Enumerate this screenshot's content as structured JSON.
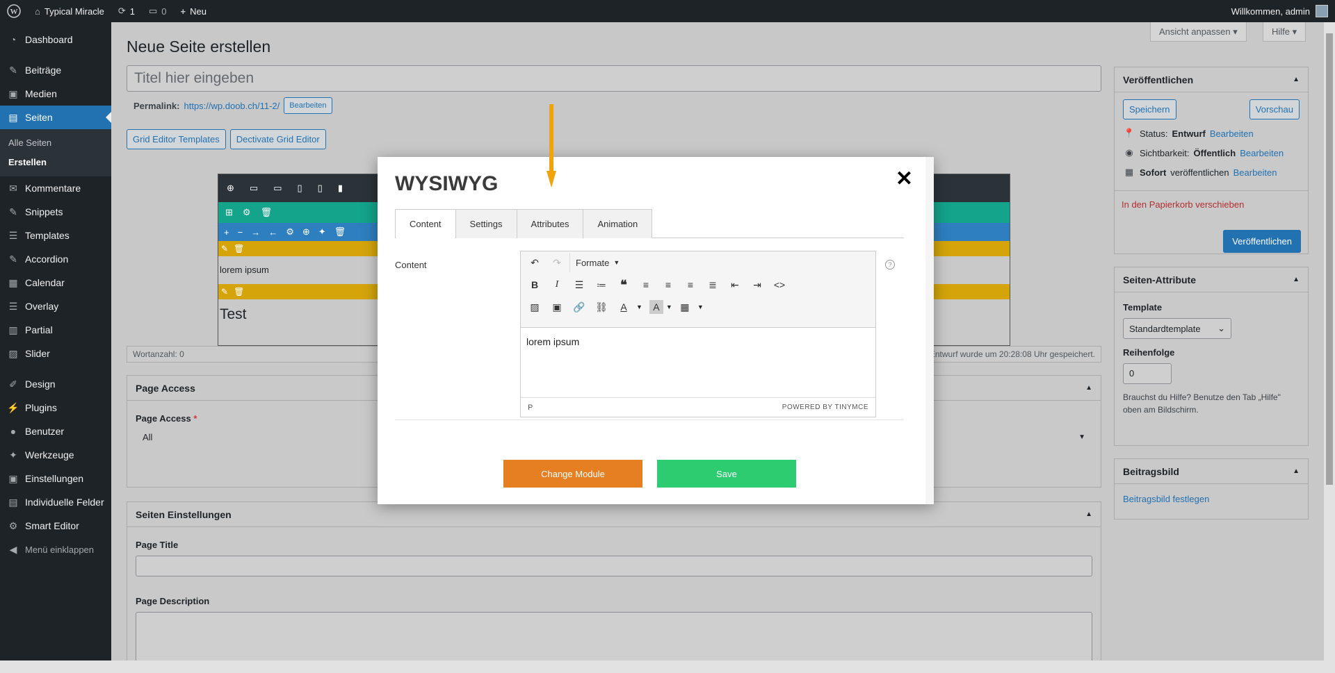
{
  "adminbar": {
    "site_name": "Typical Miracle",
    "updates_count": "1",
    "comments_count": "0",
    "new_label": "Neu",
    "greeting": "Willkommen, admin"
  },
  "sidebar": {
    "items": [
      {
        "label": "Dashboard",
        "icon": "dashboard-icon"
      },
      {
        "label": "Beiträge",
        "icon": "pin-icon"
      },
      {
        "label": "Medien",
        "icon": "media-icon"
      },
      {
        "label": "Seiten",
        "icon": "pages-icon"
      },
      {
        "label": "Kommentare",
        "icon": "comment-icon"
      },
      {
        "label": "Snippets",
        "icon": "pin-icon"
      },
      {
        "label": "Templates",
        "icon": "list-icon"
      },
      {
        "label": "Accordion",
        "icon": "pin-icon"
      },
      {
        "label": "Calendar",
        "icon": "calendar-icon"
      },
      {
        "label": "Overlay",
        "icon": "list-icon"
      },
      {
        "label": "Partial",
        "icon": "grid-icon"
      },
      {
        "label": "Slider",
        "icon": "slider-icon"
      },
      {
        "label": "Design",
        "icon": "brush-icon"
      },
      {
        "label": "Plugins",
        "icon": "plugin-icon"
      },
      {
        "label": "Benutzer",
        "icon": "user-icon"
      },
      {
        "label": "Werkzeuge",
        "icon": "wrench-icon"
      },
      {
        "label": "Einstellungen",
        "icon": "settings-icon"
      },
      {
        "label": "Individuelle Felder",
        "icon": "grid-icon"
      },
      {
        "label": "Smart Editor",
        "icon": "gear-icon"
      },
      {
        "label": "Menü einklappen",
        "icon": "collapse-icon"
      }
    ],
    "submenu": [
      "Alle Seiten",
      "Erstellen"
    ]
  },
  "header": {
    "screen_options": "Ansicht anpassen",
    "help": "Hilfe",
    "page_title": "Neue Seite erstellen",
    "title_placeholder": "Titel hier eingeben",
    "permalink_label": "Permalink:",
    "permalink_url": "https://wp.doob.ch/11-2/",
    "permalink_edit": "Bearbeiten",
    "grid_templates_btn": "Grid Editor Templates",
    "deactivate_grid_btn": "Dectivate Grid Editor"
  },
  "grid": {
    "text1": "lorem ipsum",
    "text2": "Test"
  },
  "wordcount": {
    "label": "Wortanzahl: 0",
    "saved": "Entwurf wurde um 20:28:08 Uhr gespeichert."
  },
  "page_access": {
    "title": "Page Access",
    "field_label": "Page Access",
    "required": "*",
    "value": "All"
  },
  "seiten_einstellungen": {
    "title": "Seiten Einstellungen",
    "page_title_label": "Page Title",
    "page_description_label": "Page Description"
  },
  "publish": {
    "title": "Veröffentlichen",
    "save": "Speichern",
    "preview": "Vorschau",
    "status_label": "Status:",
    "status_value": "Entwurf",
    "visibility_label": "Sichtbarkeit:",
    "visibility_value": "Öffentlich",
    "schedule_strong": "Sofort",
    "schedule_text": "veröffentlichen",
    "edit": "Bearbeiten",
    "trash": "In den Papierkorb verschieben",
    "publish_btn": "Veröffentlichen"
  },
  "attributes": {
    "title": "Seiten-Attribute",
    "template_label": "Template",
    "template_value": "Standardtemplate",
    "order_label": "Reihenfolge",
    "order_value": "0",
    "help_text": "Brauchst du Hilfe? Benutze den Tab „Hilfe\" oben am Bildschirm."
  },
  "featured": {
    "title": "Beitragsbild",
    "link": "Beitragsbild festlegen"
  },
  "modal": {
    "title": "WYSIWYG",
    "tabs": [
      "Content",
      "Settings",
      "Attributes",
      "Animation"
    ],
    "content_label": "Content",
    "formats_label": "Formate",
    "editor_text": "lorem ipsum",
    "path": "P",
    "powered": "POWERED BY TINYMCE",
    "change_module": "Change Module",
    "save": "Save"
  },
  "colors": {
    "accent": "#2271b1",
    "orange_button": "#e67e22",
    "green_button": "#2ecc71",
    "arrow": "#f0a30a"
  }
}
